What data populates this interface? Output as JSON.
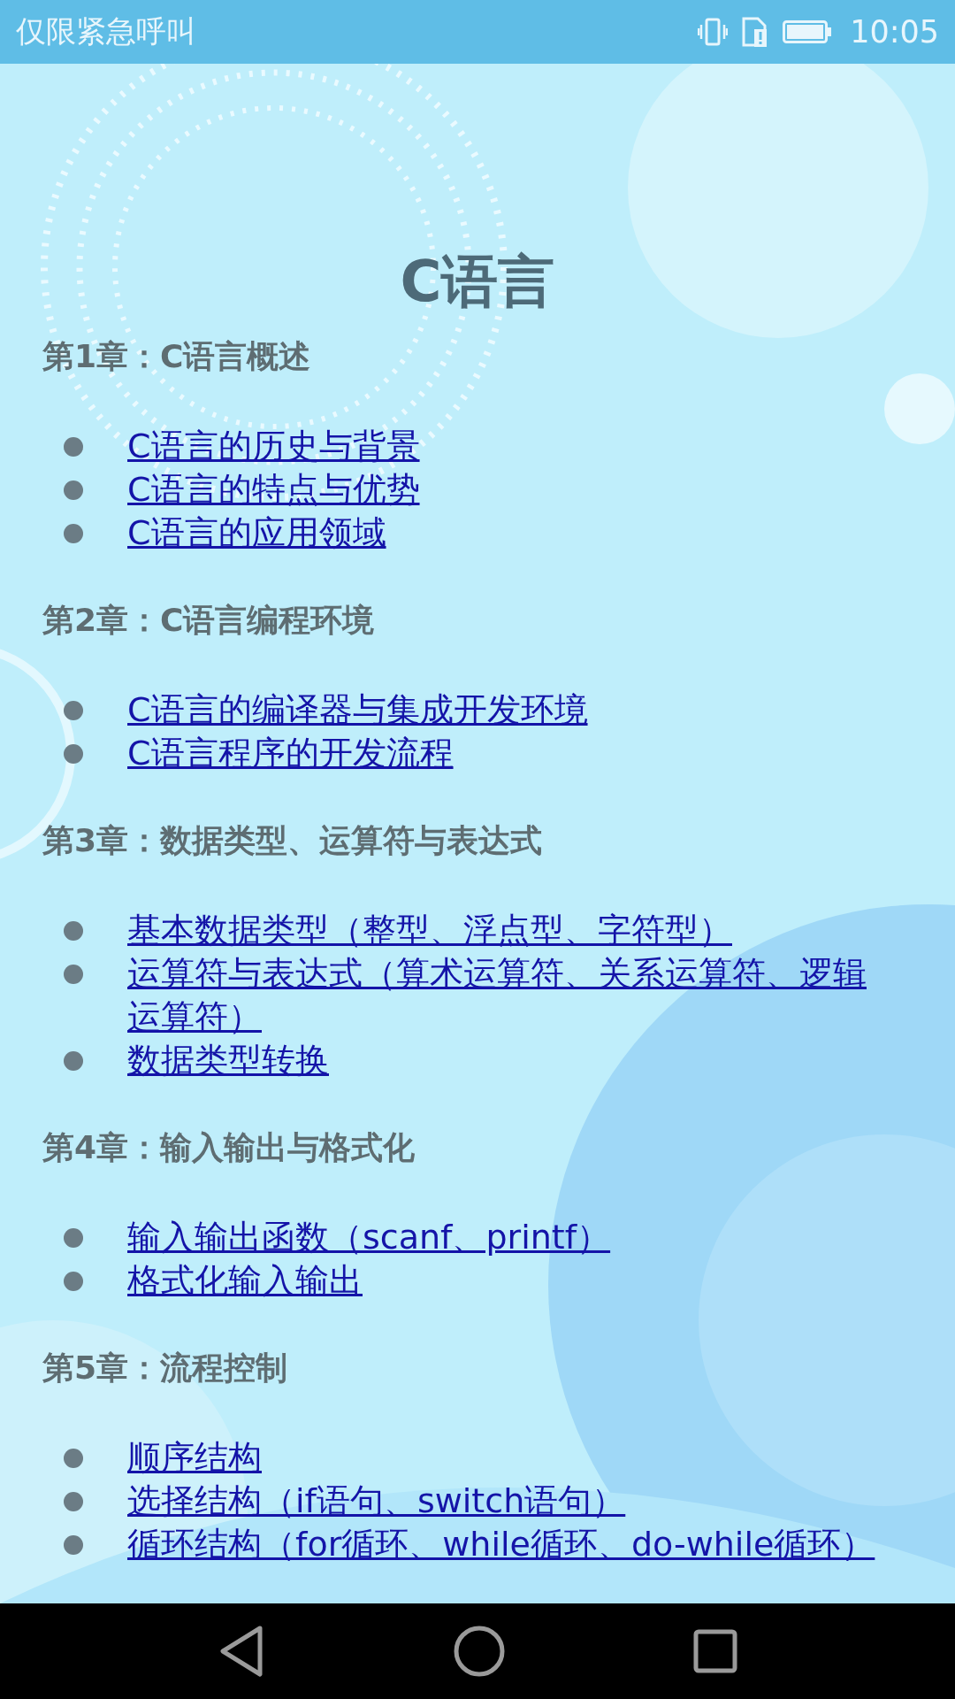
{
  "status_bar": {
    "notice": "仅限紧急呼叫",
    "time": "10:05"
  },
  "title": "C语言",
  "chapters": [
    {
      "heading": "第1章：C语言概述",
      "items": [
        "C语言的历史与背景",
        "C语言的特点与优势",
        "C语言的应用领域"
      ]
    },
    {
      "heading": "第2章：C语言编程环境",
      "items": [
        "C语言的编译器与集成开发环境",
        "C语言程序的开发流程"
      ]
    },
    {
      "heading": "第3章：数据类型、运算符与表达式",
      "items": [
        "基本数据类型（整型、浮点型、字符型）",
        "运算符与表达式（算术运算符、关系运算符、逻辑运算符）",
        "数据类型转换"
      ]
    },
    {
      "heading": "第4章：输入输出与格式化",
      "items": [
        "输入输出函数（scanf、printf）",
        "格式化输入输出"
      ]
    },
    {
      "heading": "第5章：流程控制",
      "items": [
        "顺序结构",
        "选择结构（if语句、switch语句）",
        "循环结构（for循环、while循环、do-while循环）"
      ]
    }
  ]
}
